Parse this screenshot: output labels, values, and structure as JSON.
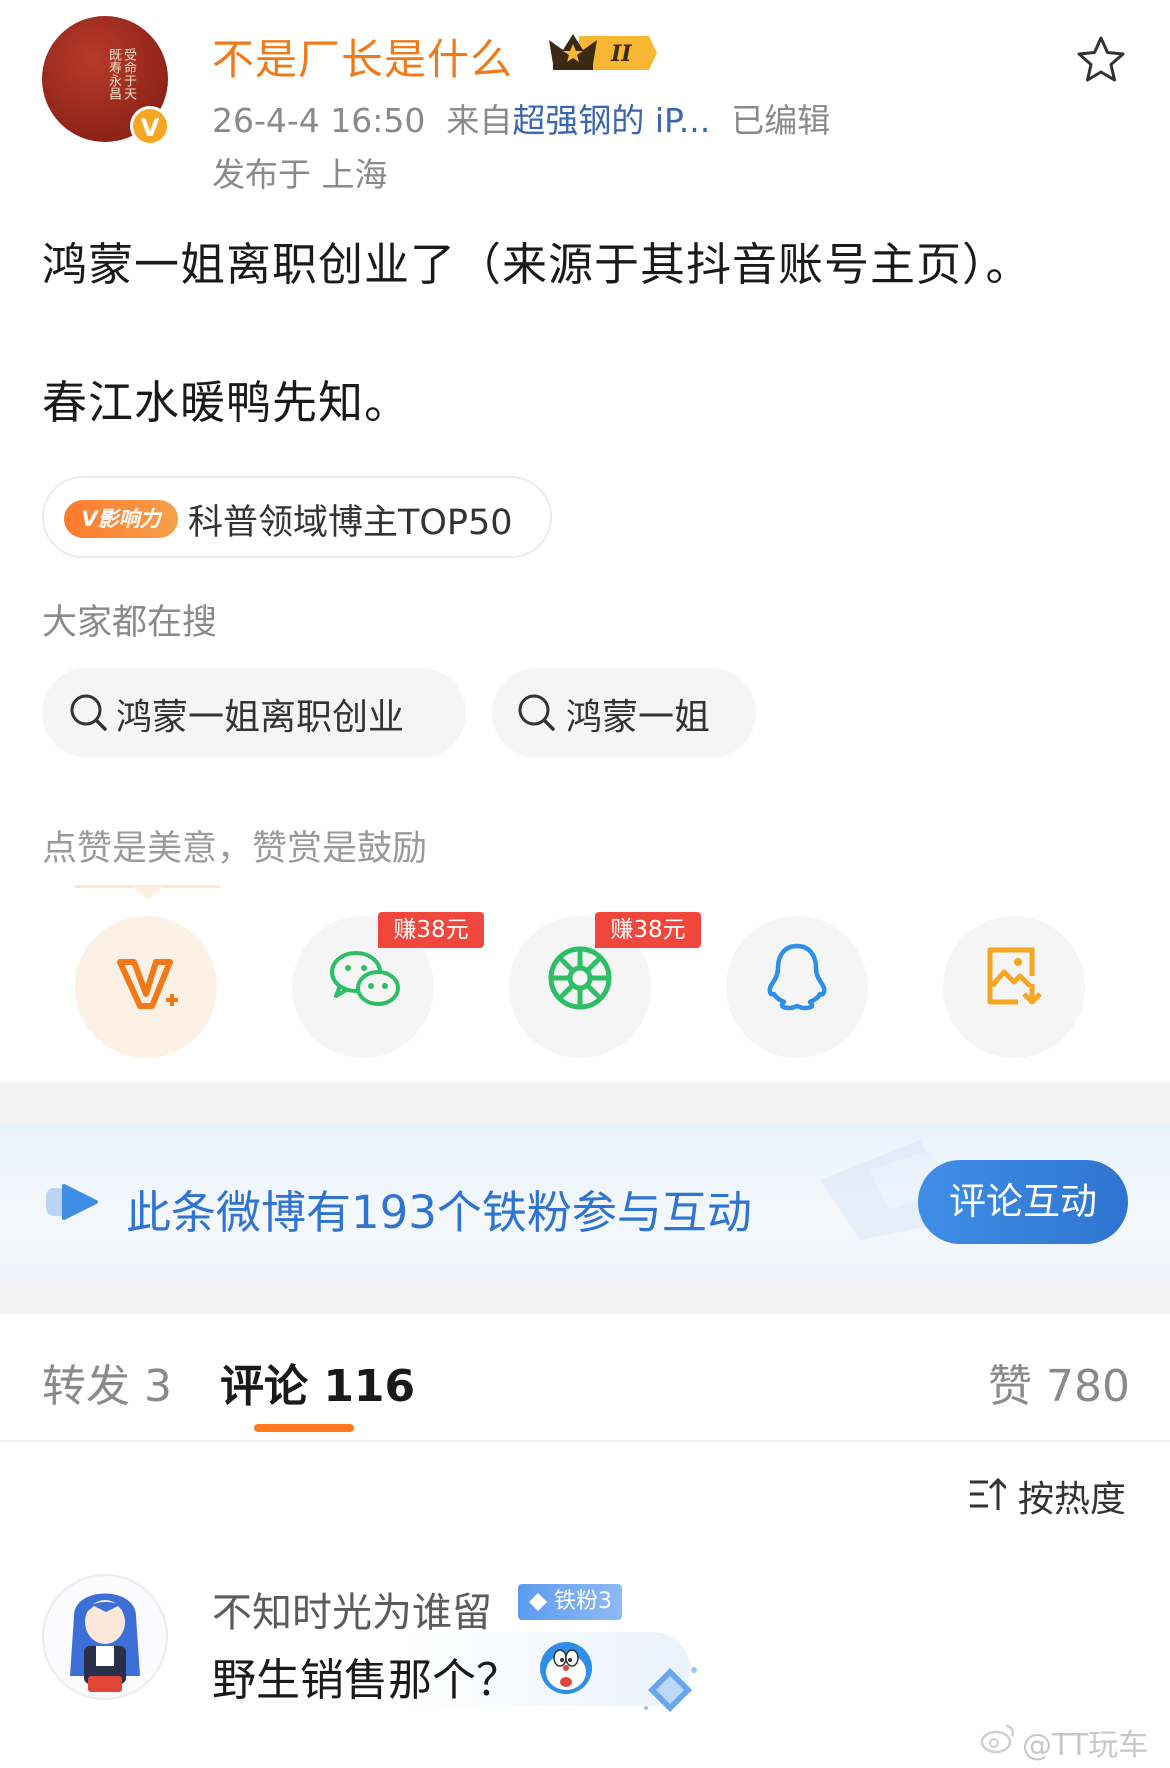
{
  "post": {
    "username": "不是厂长是什么",
    "level_badge": "II",
    "avatar_seal_text": "受命于天既寿永昌",
    "verify_mark": "V",
    "meta": {
      "time": "26-4-4 16:50",
      "from_prefix": "来自",
      "source": "超强钢的 iP...",
      "edited": "已编辑"
    },
    "location": "发布于 上海",
    "paragraphs": [
      "鸿蒙一姐离职创业了（来源于其抖音账号主页）。",
      "春江水暖鸭先知。"
    ],
    "influence": {
      "tag": "V影响力",
      "text": "科普领域博主TOP50"
    }
  },
  "search": {
    "label": "大家都在搜",
    "chips": [
      "鸿蒙一姐离职创业",
      "鸿蒙一姐"
    ]
  },
  "reward": {
    "label": "点赞是美意，赞赏是鼓励",
    "share_items": [
      {
        "icon": "v-reward-icon"
      },
      {
        "icon": "wechat-icon",
        "earn": "赚38元"
      },
      {
        "icon": "moments-icon",
        "earn": "赚38元"
      },
      {
        "icon": "qq-icon"
      },
      {
        "icon": "save-image-icon"
      }
    ]
  },
  "fan_banner": {
    "text": "此条微博有193个铁粉参与互动",
    "button": "评论互动"
  },
  "tabs": {
    "repost": "转发 3",
    "comment": "评论 116",
    "like": "赞 780"
  },
  "sort": {
    "label": "按热度"
  },
  "comments": [
    {
      "name": "不知时光为谁留",
      "badge": "铁粉3",
      "text": "野生销售那个？"
    }
  ],
  "watermark": "@TT玩车",
  "colors": {
    "accent_orange": "#f07a1a",
    "link_blue": "#2f74d0",
    "earn_red": "#f0463c"
  }
}
